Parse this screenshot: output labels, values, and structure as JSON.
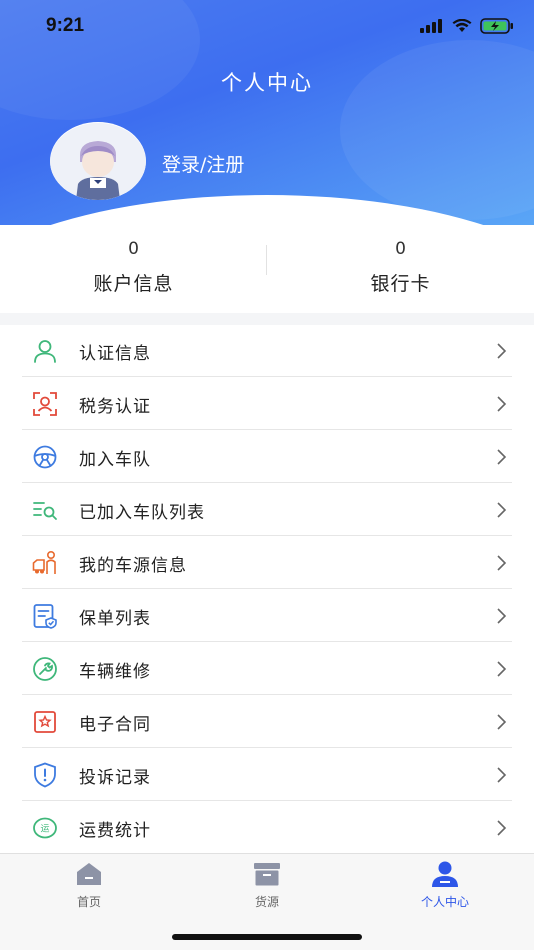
{
  "status": {
    "time": "9:21"
  },
  "header": {
    "title": "个人中心",
    "login_label": "登录/注册"
  },
  "stats": [
    {
      "value": "0",
      "label": "账户信息"
    },
    {
      "value": "0",
      "label": "银行卡"
    }
  ],
  "menu": [
    {
      "label": "认证信息",
      "icon": "user-icon",
      "color": "#3fb77a"
    },
    {
      "label": "税务认证",
      "icon": "face-scan-icon",
      "color": "#e24a3b"
    },
    {
      "label": "加入车队",
      "icon": "steering-wheel-icon",
      "color": "#3e7be0"
    },
    {
      "label": "已加入车队列表",
      "icon": "list-search-icon",
      "color": "#3fb77a"
    },
    {
      "label": "我的车源信息",
      "icon": "truck-driver-icon",
      "color": "#e86a2e"
    },
    {
      "label": "保单列表",
      "icon": "policy-doc-icon",
      "color": "#3e7be0"
    },
    {
      "label": "车辆维修",
      "icon": "wrench-icon",
      "color": "#3fb77a"
    },
    {
      "label": "电子合同",
      "icon": "contract-icon",
      "color": "#e24a3b"
    },
    {
      "label": "投诉记录",
      "icon": "shield-alert-icon",
      "color": "#3e7be0"
    },
    {
      "label": "运费统计",
      "icon": "freight-icon",
      "color": "#3fb77a",
      "badge": "运"
    }
  ],
  "tabbar": [
    {
      "label": "首页",
      "icon": "home-icon",
      "active": false
    },
    {
      "label": "货源",
      "icon": "cargo-box-icon",
      "active": false
    },
    {
      "label": "个人中心",
      "icon": "profile-icon",
      "active": true
    }
  ],
  "colors": {
    "accent": "#2d56e8",
    "header_start": "#4c7cf0",
    "header_end": "#5aa6f6"
  }
}
